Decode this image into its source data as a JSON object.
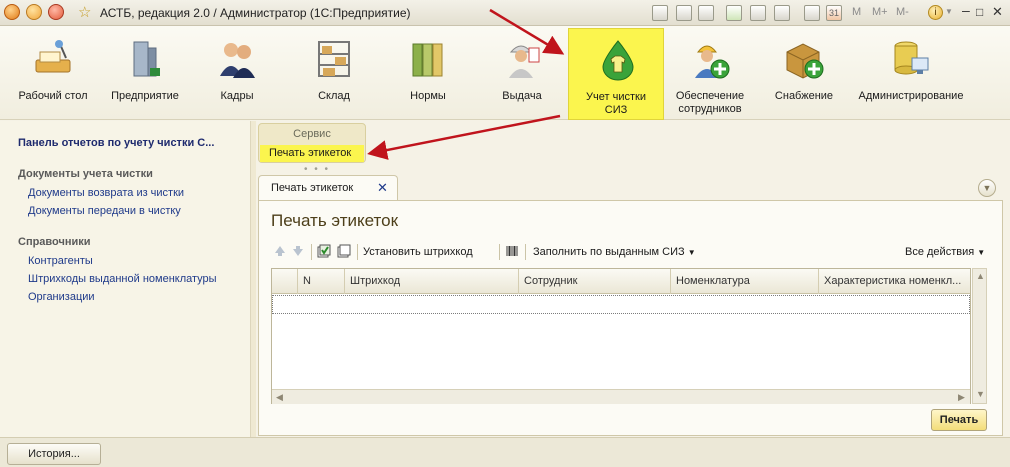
{
  "window": {
    "title": "АСТБ, редакция 2.0 / Администратор  (1С:Предприятие)",
    "memory_buttons": [
      "M",
      "M+",
      "M-"
    ]
  },
  "sections": [
    {
      "label": "Рабочий стол",
      "icon": "desk-icon"
    },
    {
      "label": "Предприятие",
      "icon": "building-icon"
    },
    {
      "label": "Кадры",
      "icon": "people-icon"
    },
    {
      "label": "Склад",
      "icon": "shelves-icon"
    },
    {
      "label": "Нормы",
      "icon": "folders-icon"
    },
    {
      "label": "Выдача",
      "icon": "worker-icon"
    },
    {
      "label": "Учет чистки СИЗ",
      "icon": "shirt-drop-icon",
      "active": true
    },
    {
      "label": "Обеспечение сотрудников",
      "icon": "worker-add-icon"
    },
    {
      "label": "Снабжение",
      "icon": "box-add-icon"
    },
    {
      "label": "Администрирование",
      "icon": "database-icon"
    }
  ],
  "left_panel": {
    "title": "Панель отчетов по учету чистки С...",
    "groups": [
      {
        "title": "Документы учета чистки",
        "items": [
          "Документы возврата из чистки",
          "Документы передачи в чистку"
        ]
      },
      {
        "title": "Справочники",
        "items": [
          "Контрагенты",
          "Штрихкоды выданной номенклатуры",
          "Организации"
        ]
      }
    ]
  },
  "servis_panel": {
    "title": "Сервис",
    "item": "Печать этикеток"
  },
  "tab": {
    "label": "Печать этикеток",
    "close": "✕"
  },
  "form": {
    "title": "Печать этикеток",
    "toolbar": {
      "set_barcode": "Установить штрихкод",
      "fill_by_issued": "Заполнить по выданным СИЗ",
      "all_actions": "Все действия"
    },
    "table": {
      "columns": [
        "N",
        "Штрихкод",
        "Сотрудник",
        "Номенклатура",
        "Характеристика номенкл..."
      ],
      "rows": []
    },
    "print_button": "Печать"
  },
  "bottom": {
    "history_button": "История..."
  },
  "colors": {
    "highlight": "#fbf54e",
    "link": "#1f3a8a",
    "annotation_arrow": "#c0141c"
  }
}
